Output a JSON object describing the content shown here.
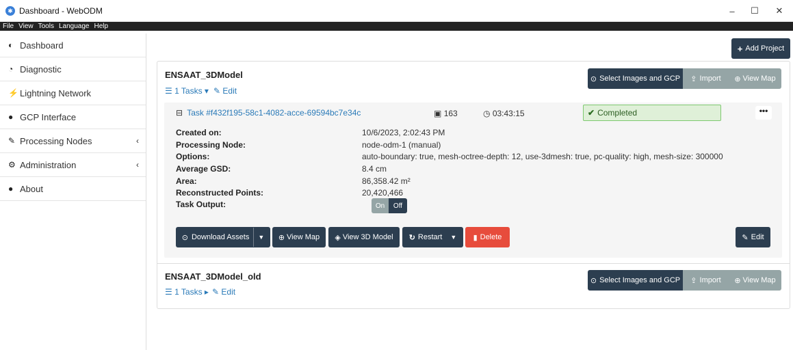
{
  "window": {
    "title": "Dashboard - WebODM",
    "minimize": "–",
    "maximize": "☐",
    "close": "✕"
  },
  "menu": [
    "File",
    "View",
    "Tools",
    "Language",
    "Help"
  ],
  "sidebar": {
    "items": [
      {
        "label": "Dashboard",
        "icon": "tachometer-icon",
        "glyph": "◐"
      },
      {
        "label": "Diagnostic",
        "icon": "chart-pie-icon",
        "glyph": "◔"
      },
      {
        "label": "Lightning Network",
        "icon": "bolt-icon",
        "glyph": "⚡"
      },
      {
        "label": "GCP Interface",
        "icon": "map-marker-icon",
        "glyph": "●"
      },
      {
        "label": "Processing Nodes",
        "icon": "wrench-icon",
        "glyph": "✎"
      },
      {
        "label": "Administration",
        "icon": "cogs-icon",
        "glyph": "⚙"
      },
      {
        "label": "About",
        "icon": "info-circle-icon",
        "glyph": "●"
      }
    ]
  },
  "header": {
    "add_project": "Add Project"
  },
  "projects": [
    {
      "name": "ENSAAT_3DModel",
      "tasks_link": "1 Tasks",
      "edit_link": "Edit",
      "select_images": "Select Images and GCP",
      "import": "Import",
      "view_map": "View Map"
    },
    {
      "name": "ENSAAT_3DModel_old",
      "tasks_link": "1 Tasks",
      "edit_link": "Edit",
      "select_images": "Select Images and GCP",
      "import": "Import",
      "view_map": "View Map"
    }
  ],
  "task": {
    "name": "Task #f432f195-58c1-4082-acce-69594bc7e34c",
    "images": "163",
    "duration": "03:43:15",
    "status": "Completed",
    "menu": "•••",
    "details": {
      "created_label": "Created on:",
      "created": "10/6/2023, 2:02:43 PM",
      "node_label": "Processing Node:",
      "node": "node-odm-1 (manual)",
      "options_label": "Options:",
      "options": "auto-boundary: true, mesh-octree-depth: 12, use-3dmesh: true, pc-quality: high, mesh-size: 300000",
      "gsd_label": "Average GSD:",
      "gsd": "8.4 cm",
      "area_label": "Area:",
      "area": "86,358.42 m²",
      "points_label": "Reconstructed Points:",
      "points": "20,420,466",
      "output_label": "Task Output:"
    },
    "toggle": {
      "on": "On",
      "off": "Off"
    },
    "actions": {
      "download": "Download Assets",
      "view_map": "View Map",
      "view_3d": "View 3D Model",
      "restart": "Restart",
      "delete": "Delete",
      "edit": "Edit"
    }
  }
}
